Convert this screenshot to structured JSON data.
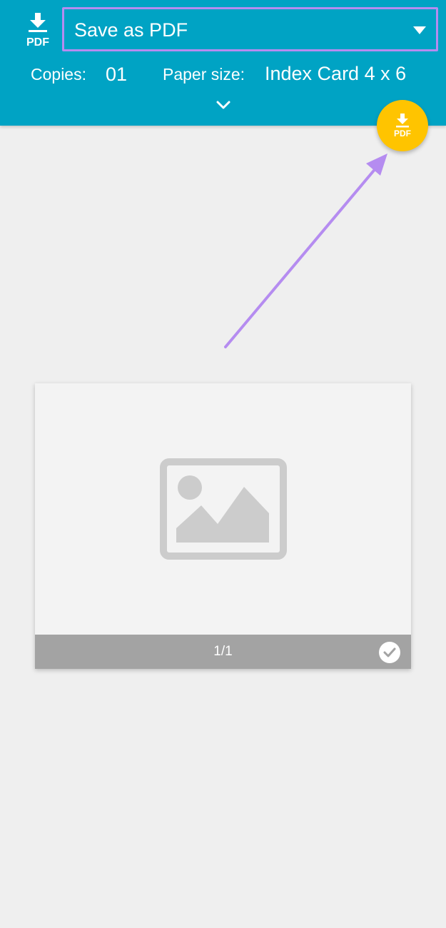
{
  "header": {
    "logo_text": "PDF",
    "printer_select": {
      "value": "Save as PDF"
    },
    "copies": {
      "label": "Copies:",
      "value": "01"
    },
    "paper_size": {
      "label": "Paper size:",
      "value": "Index Card 4 x 6"
    }
  },
  "fab": {
    "label": "PDF"
  },
  "preview": {
    "page_number": "1/1"
  },
  "colors": {
    "header_bg": "#00a3c4",
    "fab_bg": "#ffc400",
    "annotation": "#b58cf0",
    "page_footer": "#a3a3a3"
  },
  "icons": [
    "pdf-download-icon",
    "dropdown-caret-icon",
    "chevron-down-icon",
    "image-placeholder-icon",
    "check-circle-icon"
  ]
}
